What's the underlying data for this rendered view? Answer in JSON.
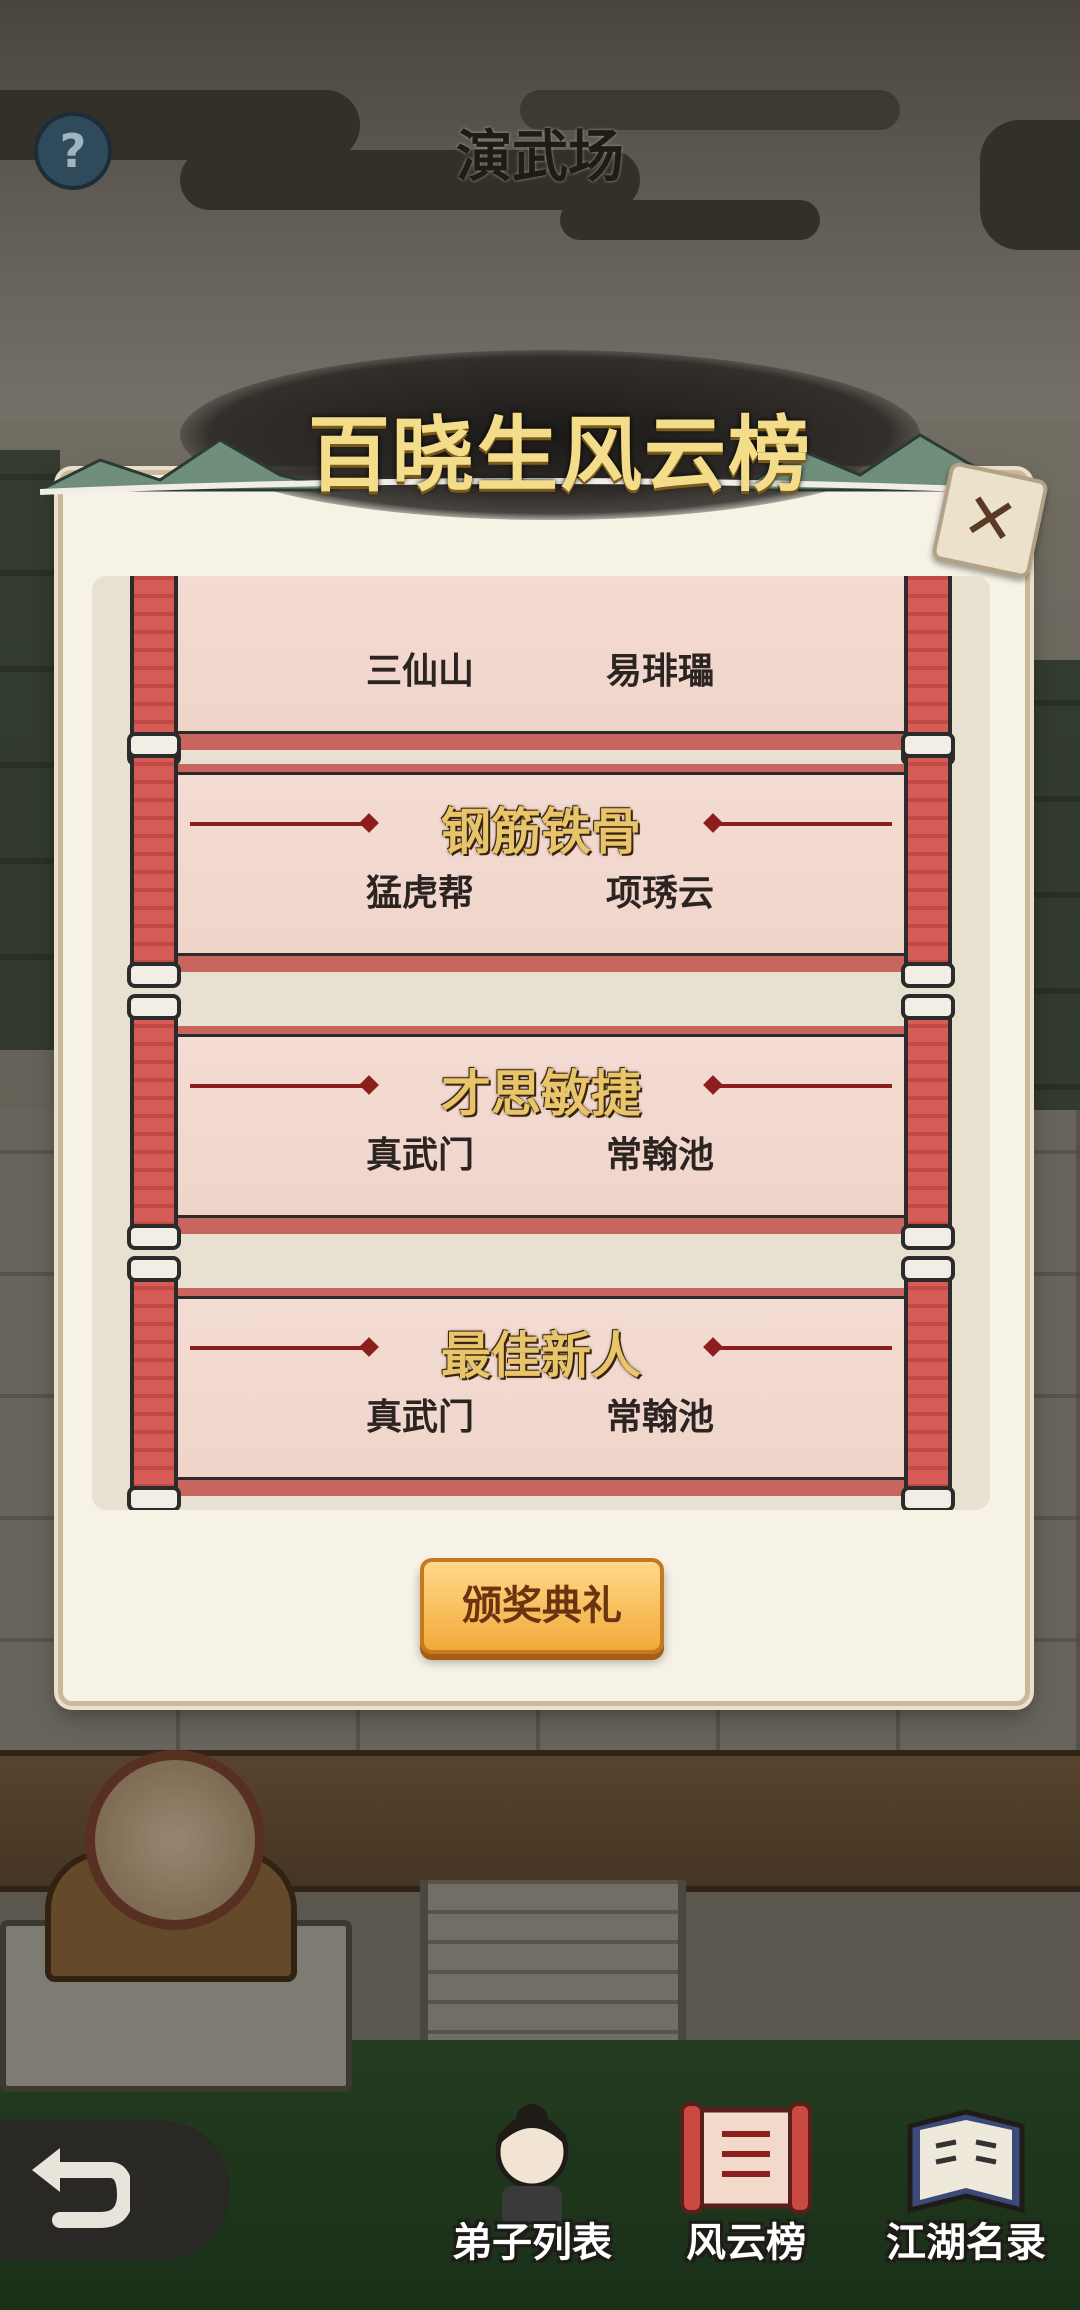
{
  "header": {
    "help_symbol": "?",
    "title": "演武场"
  },
  "modal": {
    "title": "百晓生风云榜",
    "close_symbol": "✕",
    "awards": [
      {
        "title": "",
        "sect": "三仙山",
        "winner": "易琲瓃"
      },
      {
        "title": "钢筋铁骨",
        "sect": "猛虎帮",
        "winner": "项琇云"
      },
      {
        "title": "才思敏捷",
        "sect": "真武门",
        "winner": "常翰池"
      },
      {
        "title": "最佳新人",
        "sect": "真武门",
        "winner": "常翰池"
      }
    ],
    "ceremony_button": "颁奖典礼"
  },
  "bottom_nav": {
    "items": [
      {
        "label": "弟子列表",
        "icon": "disciple-portrait-icon"
      },
      {
        "label": "风云榜",
        "icon": "ranking-scroll-icon"
      },
      {
        "label": "江湖名录",
        "icon": "book-icon"
      }
    ]
  },
  "colors": {
    "scroll_red": "#c9655f",
    "award_gold": "#e8c56b",
    "button_orange": "#f3a93a"
  }
}
